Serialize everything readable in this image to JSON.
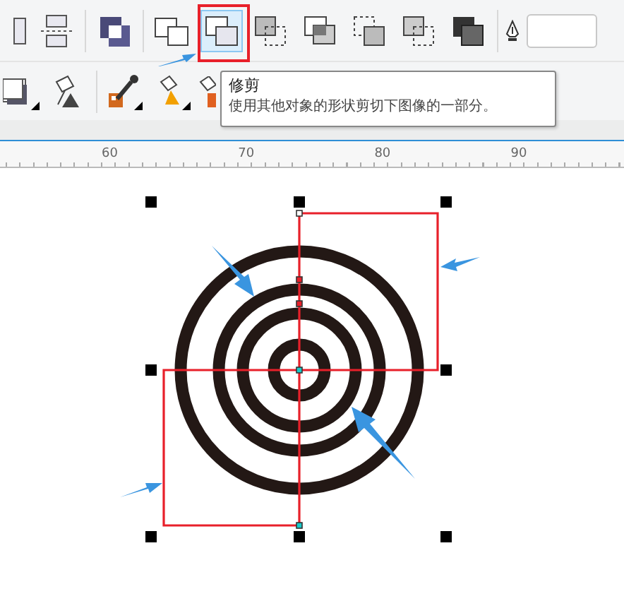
{
  "toolbar_top": [
    {
      "selected": false
    },
    {
      "selected": false
    },
    {
      "selected": false
    },
    {
      "selected": false
    },
    {
      "selected": true
    },
    {
      "selected": false
    },
    {
      "selected": false
    },
    {
      "selected": false
    },
    {
      "selected": false
    },
    {
      "selected": false
    }
  ],
  "tooltip": {
    "title": "修剪",
    "description": "使用其他对象的形状剪切下图像的一部分。"
  },
  "ruler": {
    "labels": [
      "60",
      "70",
      "80",
      "90"
    ]
  }
}
